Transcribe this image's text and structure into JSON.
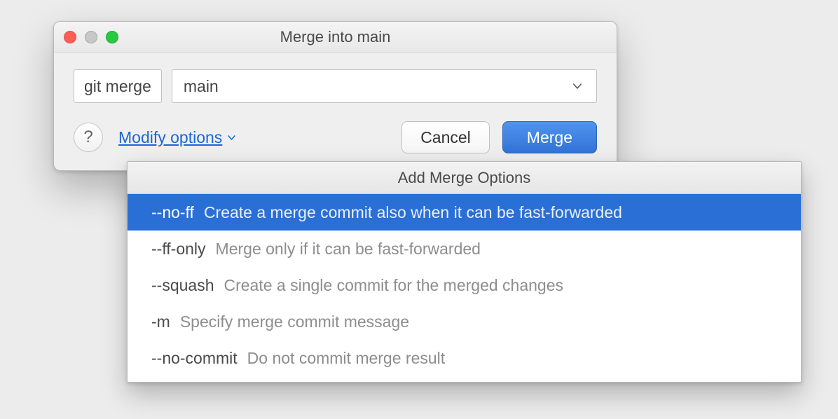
{
  "window": {
    "title": "Merge into main"
  },
  "command": {
    "prefix": "git merge",
    "branch": "main"
  },
  "controls": {
    "help_symbol": "?",
    "modify_options_label": "Modify options",
    "cancel_label": "Cancel",
    "merge_label": "Merge"
  },
  "popup": {
    "title": "Add Merge Options",
    "options": [
      {
        "flag": "--no-ff",
        "desc": "Create a merge commit also when it can be fast-forwarded",
        "selected": true
      },
      {
        "flag": "--ff-only",
        "desc": "Merge only if it can be fast-forwarded",
        "selected": false
      },
      {
        "flag": "--squash",
        "desc": "Create a single commit for the merged changes",
        "selected": false
      },
      {
        "flag": "-m",
        "desc": "Specify merge commit message",
        "selected": false
      },
      {
        "flag": "--no-commit",
        "desc": "Do not commit merge result",
        "selected": false
      }
    ]
  }
}
